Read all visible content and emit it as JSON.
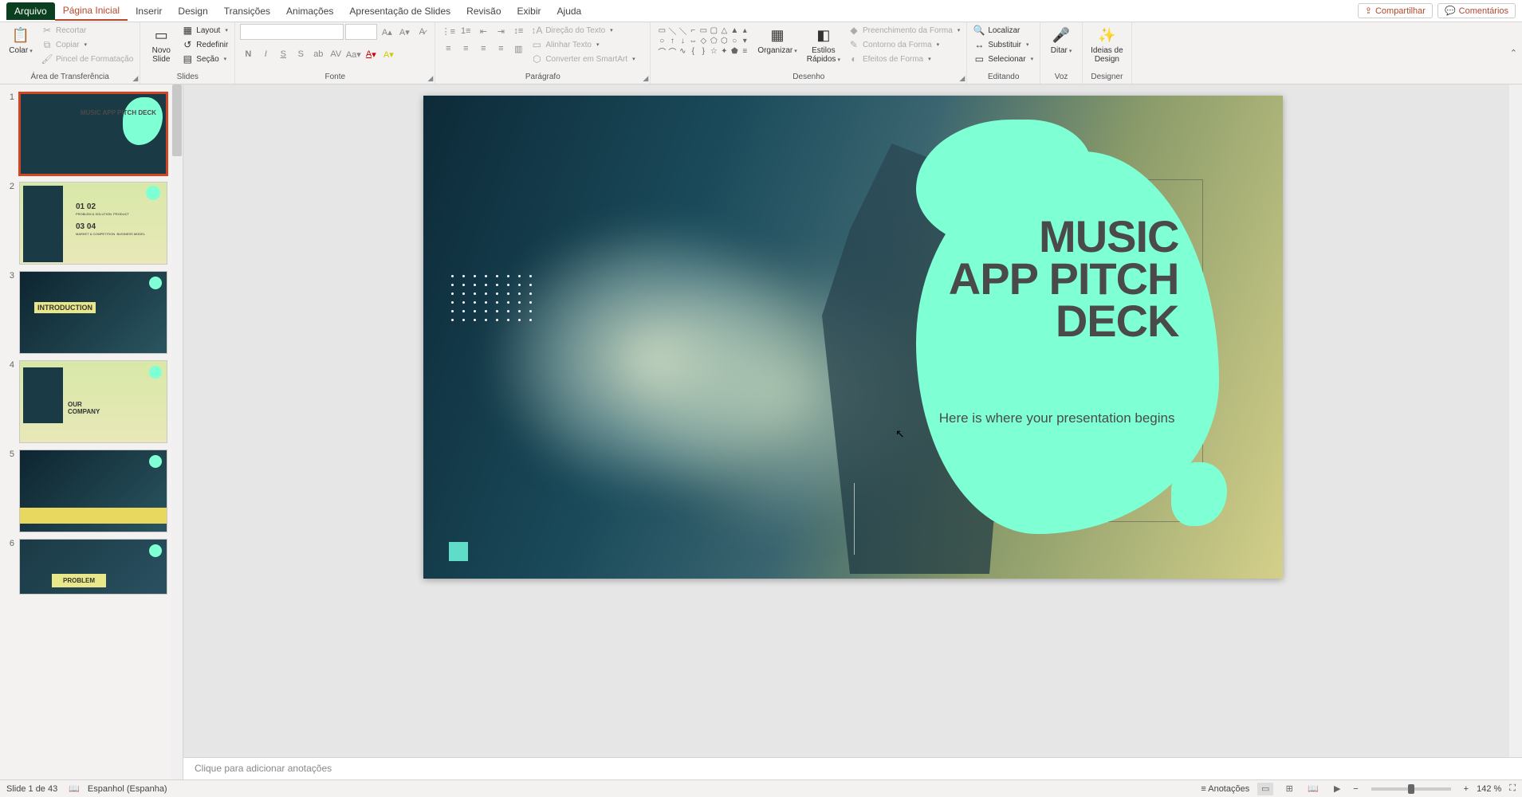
{
  "tabs": {
    "file": "Arquivo",
    "home": "Página Inicial",
    "insert": "Inserir",
    "design": "Design",
    "transitions": "Transições",
    "animations": "Animações",
    "slideshow": "Apresentação de Slides",
    "review": "Revisão",
    "view": "Exibir",
    "help": "Ajuda"
  },
  "share": {
    "share": "Compartilhar",
    "comments": "Comentários"
  },
  "ribbon": {
    "clipboard": {
      "label": "Área de Transferência",
      "paste": "Colar",
      "cut": "Recortar",
      "copy": "Copiar",
      "painter": "Pincel de Formatação"
    },
    "slides": {
      "label": "Slides",
      "new": "Novo\nSlide",
      "layout": "Layout",
      "reset": "Redefinir",
      "section": "Seção"
    },
    "font": {
      "label": "Fonte"
    },
    "paragraph": {
      "label": "Parágrafo",
      "direction": "Direção do Texto",
      "align": "Alinhar Texto",
      "smartart": "Converter em SmartArt"
    },
    "drawing": {
      "label": "Desenho",
      "arrange": "Organizar",
      "styles": "Estilos\nRápidos",
      "fill": "Preenchimento da Forma",
      "outline": "Contorno da Forma",
      "effects": "Efeitos de Forma"
    },
    "editing": {
      "label": "Editando",
      "find": "Localizar",
      "replace": "Substituir",
      "select": "Selecionar"
    },
    "voice": {
      "label": "Voz",
      "dictate": "Ditar"
    },
    "designer": {
      "label": "Designer",
      "ideas": "Ideias de\nDesign"
    }
  },
  "slide": {
    "title": "MUSIC\nAPP PITCH\nDECK",
    "subtitle": "Here is where your presentation begins"
  },
  "thumbs": {
    "t1": "MUSIC APP PITCH DECK",
    "t2": {
      "a": "01",
      "b": "02",
      "c": "03",
      "d": "04",
      "l1": "PROBLEM & SOLUTION",
      "l2": "PRODUCT",
      "l3": "MARKET & COMPETITION",
      "l4": "BUSINESS MODEL"
    },
    "t3": "INTRODUCTION",
    "t4": "OUR\nCOMPANY",
    "t6": "PROBLEM"
  },
  "notes": "Clique para adicionar anotações",
  "status": {
    "slide": "Slide 1 de 43",
    "lang": "Espanhol (Espanha)",
    "annotations": "Anotações",
    "zoom": "142 %"
  }
}
